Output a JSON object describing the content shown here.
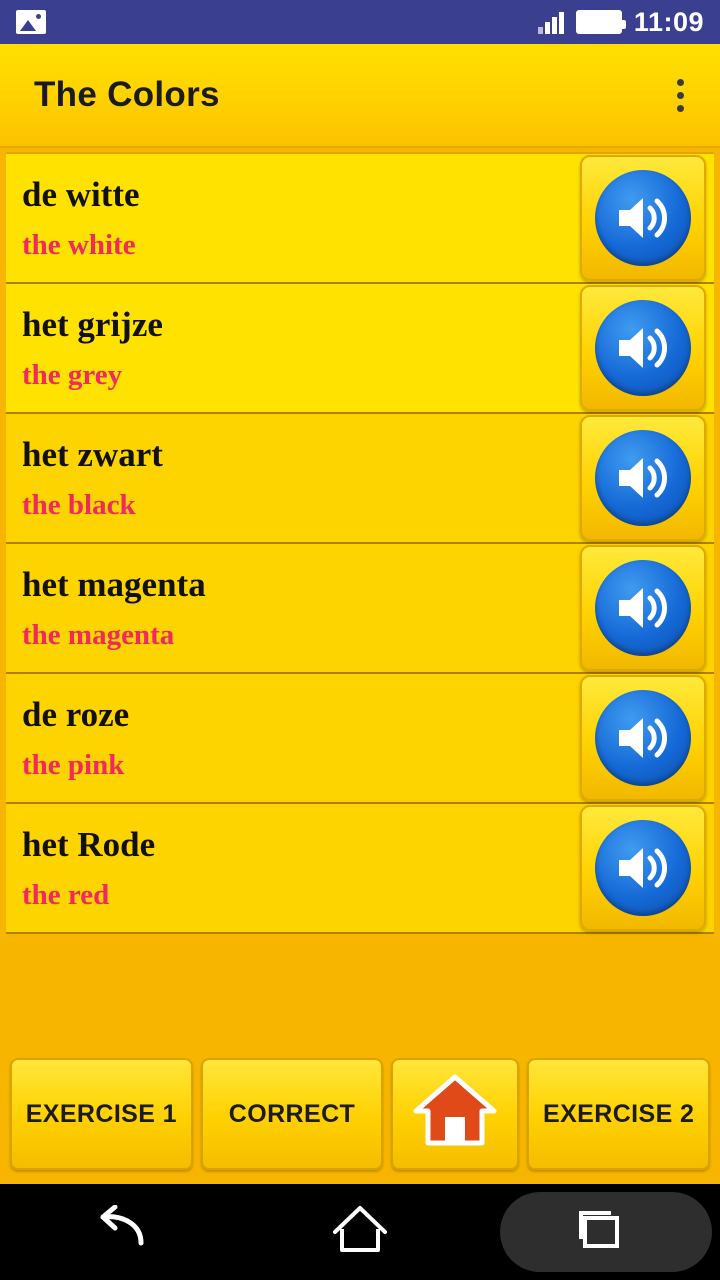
{
  "status_bar": {
    "photo_icon": "image-icon",
    "signal_icon": "signal-bars-icon",
    "battery_icon": "battery-icon",
    "time": "11:09"
  },
  "app_bar": {
    "title": "The Colors",
    "overflow_icon": "overflow-menu-icon"
  },
  "list": {
    "speaker_icon": "speaker-icon",
    "items": [
      {
        "term": "de witte",
        "translation": "the white"
      },
      {
        "term": "het grijze",
        "translation": "the grey"
      },
      {
        "term": "het zwart",
        "translation": "the black"
      },
      {
        "term": "het magenta",
        "translation": "the magenta"
      },
      {
        "term": "de roze",
        "translation": "the pink"
      },
      {
        "term": "het Rode",
        "translation": "the red"
      }
    ]
  },
  "bottom_bar": {
    "exercise1_label": "EXERCISE 1",
    "correct_label": "CORRECT",
    "home_icon": "home-icon",
    "exercise2_label": "EXERCISE 2"
  },
  "nav_bar": {
    "back_icon": "back-arrow-icon",
    "home_icon": "home-outline-icon",
    "recents_icon": "recent-apps-icon"
  },
  "colors": {
    "status_bar_bg": "#3b3f8f",
    "app_bg": "#f7b500",
    "accent_yellow": "#ffd400",
    "translation_pink": "#f0295e",
    "speaker_blue": "#1569d6"
  }
}
